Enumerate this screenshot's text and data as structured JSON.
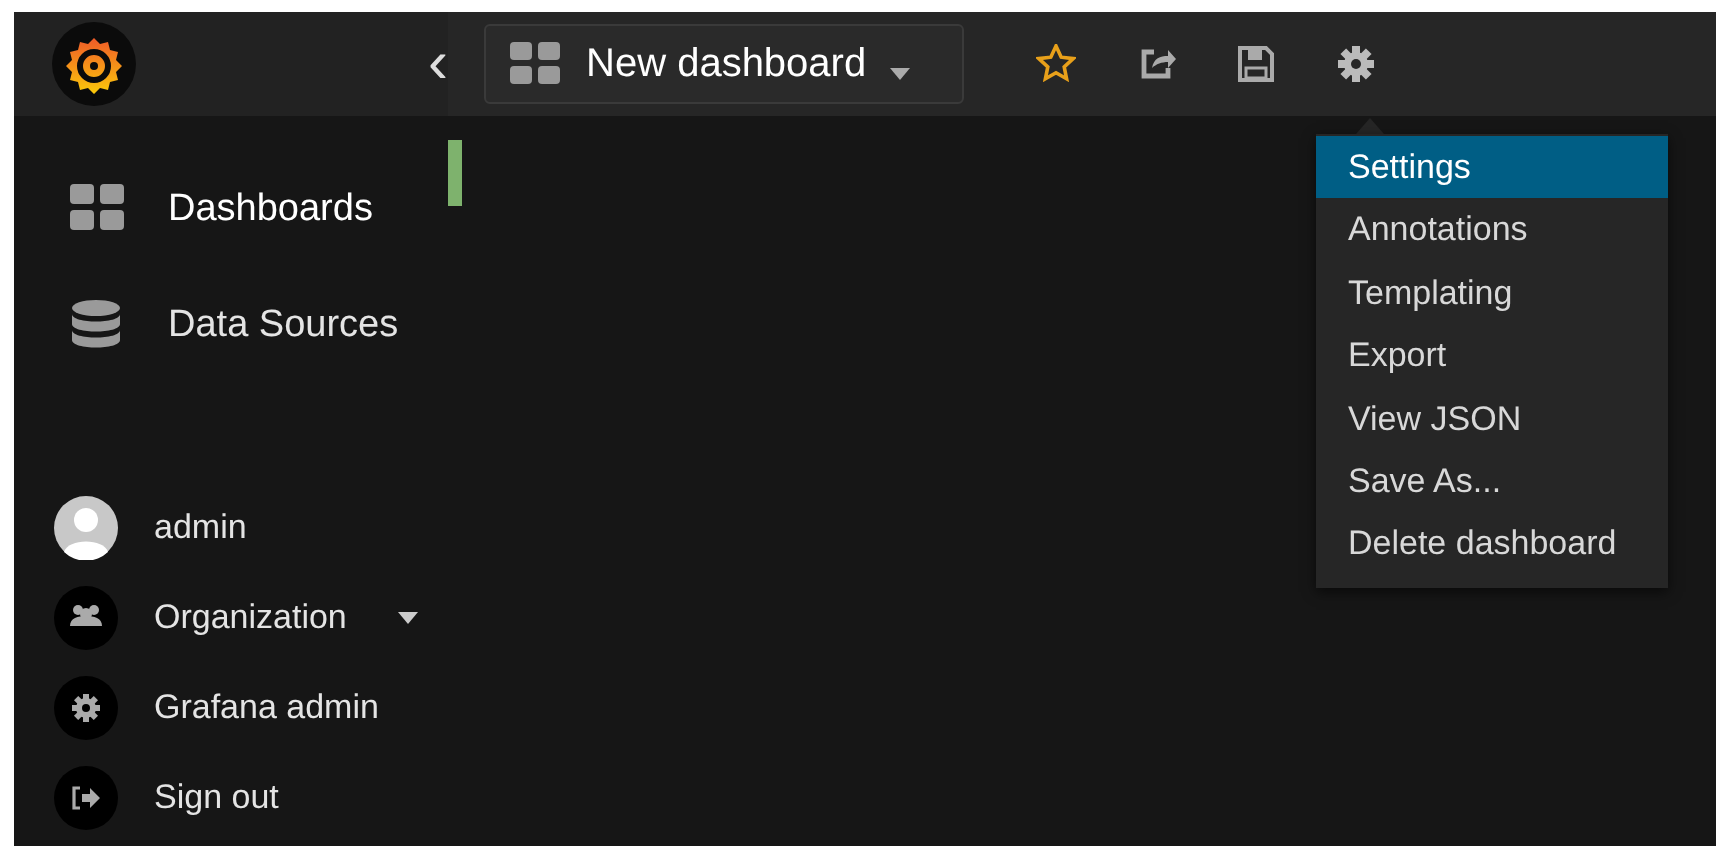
{
  "topbar": {
    "back_icon": "‹",
    "dashboard_title": "New dashboard",
    "toolbar": [
      {
        "kind": "star",
        "starred": false
      },
      {
        "kind": "share"
      },
      {
        "kind": "save"
      },
      {
        "kind": "settings"
      }
    ]
  },
  "sidebar": {
    "items": [
      {
        "kind": "dashboards",
        "label": "Dashboards",
        "selected": true
      },
      {
        "kind": "datasources",
        "label": "Data Sources",
        "selected": false
      }
    ],
    "user_items": [
      {
        "kind": "avatar",
        "label": "admin",
        "has_caret": false
      },
      {
        "kind": "org",
        "label": "Organization",
        "has_caret": true
      },
      {
        "kind": "gear",
        "label": "Grafana admin",
        "has_caret": false
      },
      {
        "kind": "signout",
        "label": "Sign out",
        "has_caret": false
      }
    ]
  },
  "settings_menu": {
    "items": [
      {
        "label": "Settings",
        "selected": true
      },
      {
        "label": "Annotations",
        "selected": false
      },
      {
        "label": "Templating",
        "selected": false
      },
      {
        "label": "Export",
        "selected": false
      },
      {
        "label": "View JSON",
        "selected": false
      },
      {
        "label": "Save As...",
        "selected": false
      },
      {
        "label": "Delete dashboard",
        "selected": false
      }
    ]
  }
}
